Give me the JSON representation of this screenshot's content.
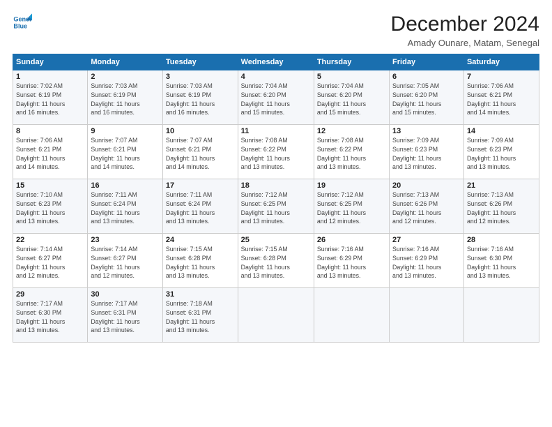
{
  "logo": {
    "line1": "General",
    "line2": "Blue"
  },
  "title": "December 2024",
  "subtitle": "Amady Ounare, Matam, Senegal",
  "days_header": [
    "Sunday",
    "Monday",
    "Tuesday",
    "Wednesday",
    "Thursday",
    "Friday",
    "Saturday"
  ],
  "weeks": [
    [
      {
        "day": "1",
        "info": "Sunrise: 7:02 AM\nSunset: 6:19 PM\nDaylight: 11 hours\nand 16 minutes."
      },
      {
        "day": "2",
        "info": "Sunrise: 7:03 AM\nSunset: 6:19 PM\nDaylight: 11 hours\nand 16 minutes."
      },
      {
        "day": "3",
        "info": "Sunrise: 7:03 AM\nSunset: 6:19 PM\nDaylight: 11 hours\nand 16 minutes."
      },
      {
        "day": "4",
        "info": "Sunrise: 7:04 AM\nSunset: 6:20 PM\nDaylight: 11 hours\nand 15 minutes."
      },
      {
        "day": "5",
        "info": "Sunrise: 7:04 AM\nSunset: 6:20 PM\nDaylight: 11 hours\nand 15 minutes."
      },
      {
        "day": "6",
        "info": "Sunrise: 7:05 AM\nSunset: 6:20 PM\nDaylight: 11 hours\nand 15 minutes."
      },
      {
        "day": "7",
        "info": "Sunrise: 7:06 AM\nSunset: 6:21 PM\nDaylight: 11 hours\nand 14 minutes."
      }
    ],
    [
      {
        "day": "8",
        "info": "Sunrise: 7:06 AM\nSunset: 6:21 PM\nDaylight: 11 hours\nand 14 minutes."
      },
      {
        "day": "9",
        "info": "Sunrise: 7:07 AM\nSunset: 6:21 PM\nDaylight: 11 hours\nand 14 minutes."
      },
      {
        "day": "10",
        "info": "Sunrise: 7:07 AM\nSunset: 6:21 PM\nDaylight: 11 hours\nand 14 minutes."
      },
      {
        "day": "11",
        "info": "Sunrise: 7:08 AM\nSunset: 6:22 PM\nDaylight: 11 hours\nand 13 minutes."
      },
      {
        "day": "12",
        "info": "Sunrise: 7:08 AM\nSunset: 6:22 PM\nDaylight: 11 hours\nand 13 minutes."
      },
      {
        "day": "13",
        "info": "Sunrise: 7:09 AM\nSunset: 6:23 PM\nDaylight: 11 hours\nand 13 minutes."
      },
      {
        "day": "14",
        "info": "Sunrise: 7:09 AM\nSunset: 6:23 PM\nDaylight: 11 hours\nand 13 minutes."
      }
    ],
    [
      {
        "day": "15",
        "info": "Sunrise: 7:10 AM\nSunset: 6:23 PM\nDaylight: 11 hours\nand 13 minutes."
      },
      {
        "day": "16",
        "info": "Sunrise: 7:11 AM\nSunset: 6:24 PM\nDaylight: 11 hours\nand 13 minutes."
      },
      {
        "day": "17",
        "info": "Sunrise: 7:11 AM\nSunset: 6:24 PM\nDaylight: 11 hours\nand 13 minutes."
      },
      {
        "day": "18",
        "info": "Sunrise: 7:12 AM\nSunset: 6:25 PM\nDaylight: 11 hours\nand 13 minutes."
      },
      {
        "day": "19",
        "info": "Sunrise: 7:12 AM\nSunset: 6:25 PM\nDaylight: 11 hours\nand 12 minutes."
      },
      {
        "day": "20",
        "info": "Sunrise: 7:13 AM\nSunset: 6:26 PM\nDaylight: 11 hours\nand 12 minutes."
      },
      {
        "day": "21",
        "info": "Sunrise: 7:13 AM\nSunset: 6:26 PM\nDaylight: 11 hours\nand 12 minutes."
      }
    ],
    [
      {
        "day": "22",
        "info": "Sunrise: 7:14 AM\nSunset: 6:27 PM\nDaylight: 11 hours\nand 12 minutes."
      },
      {
        "day": "23",
        "info": "Sunrise: 7:14 AM\nSunset: 6:27 PM\nDaylight: 11 hours\nand 12 minutes."
      },
      {
        "day": "24",
        "info": "Sunrise: 7:15 AM\nSunset: 6:28 PM\nDaylight: 11 hours\nand 13 minutes."
      },
      {
        "day": "25",
        "info": "Sunrise: 7:15 AM\nSunset: 6:28 PM\nDaylight: 11 hours\nand 13 minutes."
      },
      {
        "day": "26",
        "info": "Sunrise: 7:16 AM\nSunset: 6:29 PM\nDaylight: 11 hours\nand 13 minutes."
      },
      {
        "day": "27",
        "info": "Sunrise: 7:16 AM\nSunset: 6:29 PM\nDaylight: 11 hours\nand 13 minutes."
      },
      {
        "day": "28",
        "info": "Sunrise: 7:16 AM\nSunset: 6:30 PM\nDaylight: 11 hours\nand 13 minutes."
      }
    ],
    [
      {
        "day": "29",
        "info": "Sunrise: 7:17 AM\nSunset: 6:30 PM\nDaylight: 11 hours\nand 13 minutes."
      },
      {
        "day": "30",
        "info": "Sunrise: 7:17 AM\nSunset: 6:31 PM\nDaylight: 11 hours\nand 13 minutes."
      },
      {
        "day": "31",
        "info": "Sunrise: 7:18 AM\nSunset: 6:31 PM\nDaylight: 11 hours\nand 13 minutes."
      },
      null,
      null,
      null,
      null
    ]
  ]
}
